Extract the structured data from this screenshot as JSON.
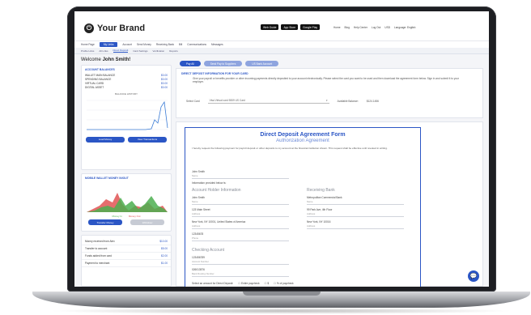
{
  "header": {
    "brand": "Your Brand",
    "badges": [
      "Web Guide",
      "App Store",
      "Google Play"
    ],
    "links": [
      "Home",
      "Blog",
      "Help Center",
      "Log Out",
      "USD",
      "Language: English"
    ]
  },
  "topnav": [
    "Home Page",
    "My Links",
    "Account",
    "Send Money",
    "Receiving Bank",
    "Bill",
    "Communications",
    "Messages"
  ],
  "topnav_active": "My Links",
  "subnav": [
    "Profile Links",
    "All Links",
    "Direct Deposit",
    "Card Settings",
    "Verification",
    "Reports"
  ],
  "subnav_selected": "Direct Deposit",
  "welcome": {
    "prefix": "Welcome",
    "name": "John Smith!"
  },
  "balances": {
    "title": "ACCOUNT BALANCES",
    "rows": [
      {
        "label": "WALLET MAIN BALANCE",
        "value": "$0.00"
      },
      {
        "label": "SPENDING BALANCE",
        "value": "$0.00"
      },
      {
        "label": "VIRTUAL CARD",
        "value": "$0.00"
      },
      {
        "label": "DIGITAL ASSET",
        "value": "$0.00"
      }
    ],
    "history_label": "BALANCE HISTORY",
    "btn_left": "Load Money",
    "btn_right": "View Transactions"
  },
  "mobile_wallet": {
    "title": "MOBILE WALLET MONEY IN/OUT",
    "legend_in": "Money In",
    "legend_out": "Money Out",
    "btn_left": "Transfer Money",
    "btn_right": "Withdraw"
  },
  "transactions": {
    "items": [
      {
        "title": "Money received from Alex",
        "amount": "$10.00"
      },
      {
        "title": "Transfer to account",
        "amount": "$5.00"
      },
      {
        "title": "Funds added from card",
        "amount": "$2.00"
      },
      {
        "title": "Payment to merchant",
        "amount": "$1.00"
      }
    ]
  },
  "tabs": [
    "Pay All",
    "Send Pay to Suppliers",
    "US Bank Account"
  ],
  "info": {
    "title": "DIRECT DEPOSIT INFORMATION FOR YOUR CARD",
    "text": "Give your payroll or benefits provider or other incoming payments directly deposited to your account electronically. Please select the card you want to be used and then download the agreement form below. Sign in and submit it to your employer.",
    "select_label": "Select Card",
    "select_value": "Visa Virtual card 5559 US Card",
    "available_label": "Available Balance:",
    "available_value": "$124.1456"
  },
  "document": {
    "title": "Direct Deposit Agreement Form",
    "subtitle": "Authorization Agreement",
    "intro": "I hereby request the following payment for payroll deposit or other deposits to my account at the financial institution shown. This request shall be effective until revoked in writing.",
    "employee_name": "John Smith",
    "employee_name_cap": "Name",
    "information_label": "Information provided below is:",
    "account_holder_head": "Account Holder Information",
    "bank_head": "Receiving Bank",
    "holder_fields": [
      {
        "value": "John Smith",
        "cap": "Name"
      },
      {
        "value": "123 Main Street",
        "cap": "Address"
      },
      {
        "value": "New York, NY 10001, United States of America",
        "cap": "Address"
      },
      {
        "value": "12345678",
        "cap": "Phone"
      }
    ],
    "bank_fields": [
      {
        "value": "Metropolitan Commercial Bank",
        "cap": "Name"
      },
      {
        "value": "99 Park Ave, 4th Floor",
        "cap": "Address"
      },
      {
        "value": "New York, NY 10016",
        "cap": "Address"
      }
    ],
    "checking_head": "Checking Account",
    "checking_fields": [
      {
        "value": "123456789",
        "cap": "Account Number"
      },
      {
        "value": "026013576",
        "cap": "Bank Routing Number"
      }
    ],
    "select_amount_label": "Select an amount for Direct Deposit:",
    "options": [
      "Entire paycheck",
      "$",
      "% of paycheck"
    ]
  }
}
